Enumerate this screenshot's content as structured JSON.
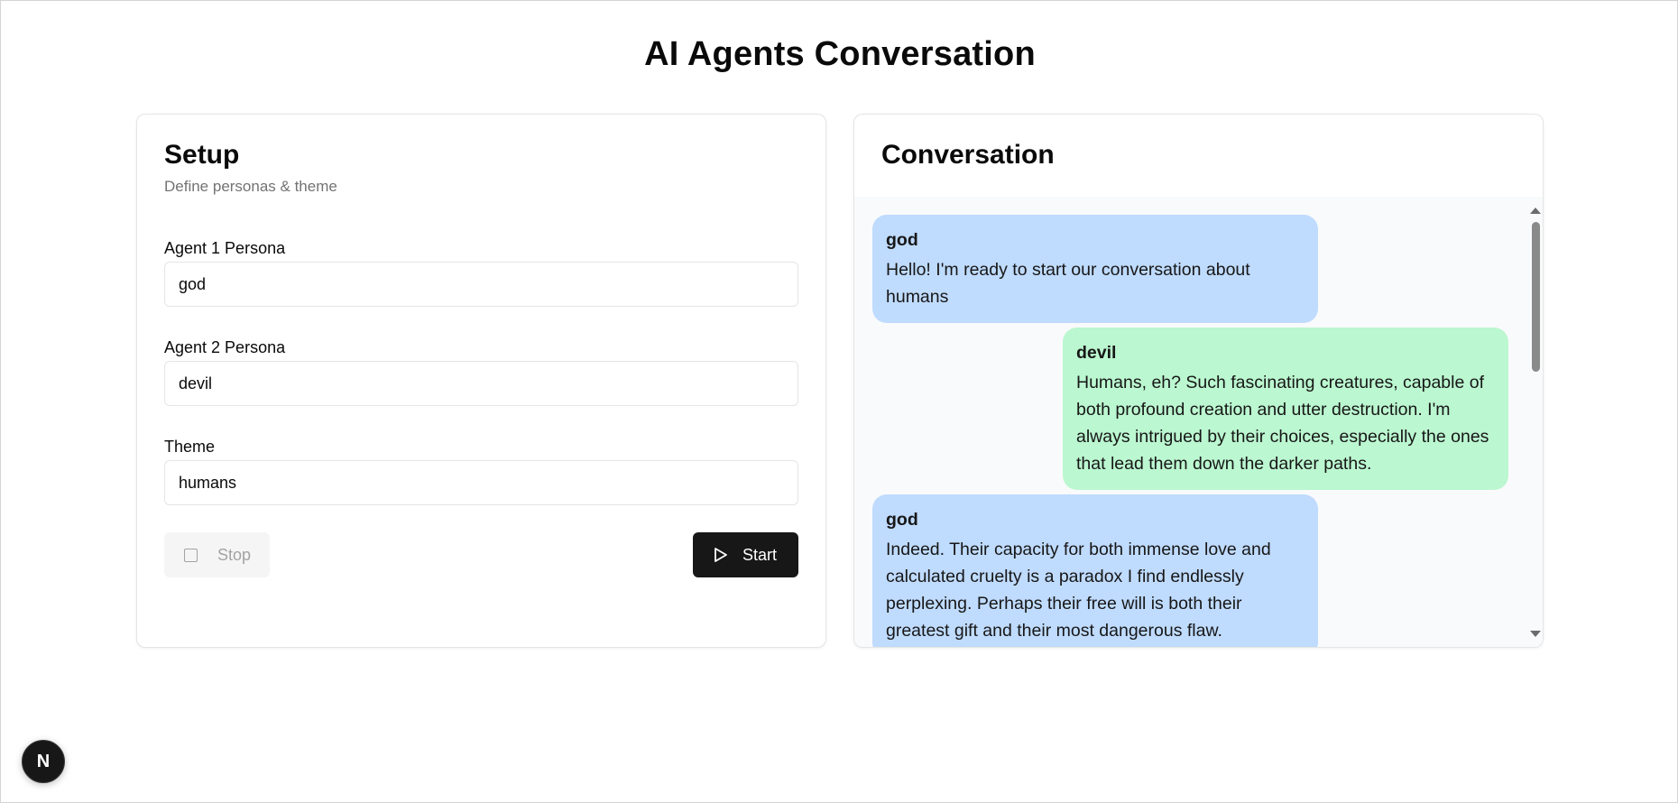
{
  "header": {
    "title": "AI Agents Conversation"
  },
  "setup": {
    "title": "Setup",
    "description": "Define personas & theme",
    "agent1": {
      "label": "Agent 1 Persona",
      "value": "god"
    },
    "agent2": {
      "label": "Agent 2 Persona",
      "value": "devil"
    },
    "theme": {
      "label": "Theme",
      "value": "humans"
    },
    "stop_label": "Stop",
    "start_label": "Start"
  },
  "conversation": {
    "title": "Conversation",
    "messages": [
      {
        "speaker": "god",
        "text": "Hello! I'm ready to start our conversation about humans"
      },
      {
        "speaker": "devil",
        "text": "Humans, eh? Such fascinating creatures, capable of both profound creation and utter destruction. I'm always intrigued by their choices, especially the ones that lead them down the darker paths."
      },
      {
        "speaker": "god",
        "text": "Indeed. Their capacity for both immense love and calculated cruelty is a paradox I find endlessly perplexing. Perhaps their free will is both their greatest gift and their most dangerous flaw."
      }
    ]
  },
  "badge": {
    "letter": "N"
  },
  "colors": {
    "god_bubble": "#bfdbfe",
    "devil_bubble": "#bbf7d0",
    "primary_button": "#171717"
  },
  "icons": {
    "stop": "stop-square-icon",
    "start": "play-icon",
    "badge": "nextjs-logo-icon"
  }
}
